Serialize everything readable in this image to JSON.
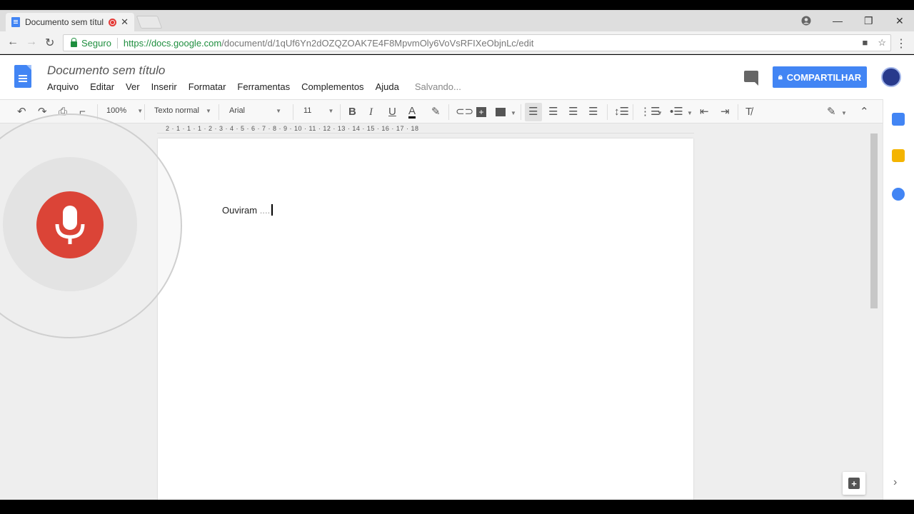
{
  "browser": {
    "tab_title": "Documento sem títul",
    "tab_close": "✕",
    "secure_label": "Seguro",
    "url_host": "https://docs.google.com",
    "url_path": "/document/d/1qUf6Yn2dOZQZOAK7E4F8MpvmOly6VoVsRFIXeObjnLc/edit",
    "window_controls": [
      "—",
      "❐",
      "✕"
    ]
  },
  "docs": {
    "title": "Documento sem título",
    "menu": [
      "Arquivo",
      "Editar",
      "Ver",
      "Inserir",
      "Formatar",
      "Ferramentas",
      "Complementos",
      "Ajuda"
    ],
    "status": "Salvando...",
    "share_label": "COMPARTILHAR"
  },
  "toolbar": {
    "zoom": "100%",
    "style": "Texto normal",
    "font": "Arial",
    "size": "11"
  },
  "ruler": "2 · 1 · 1 · 1 · 2 · 3 · 4 · 5 · 6 · 7 · 8 · 9 · 10 · 11 · 12 · 13 · 14 · 15 · 16 · 17 · 18",
  "document": {
    "text": "Ouviram",
    "listening_indicator": "...."
  },
  "colors": {
    "accent": "#4285f4",
    "mic": "#db4437",
    "secure": "#1e8e3e"
  }
}
